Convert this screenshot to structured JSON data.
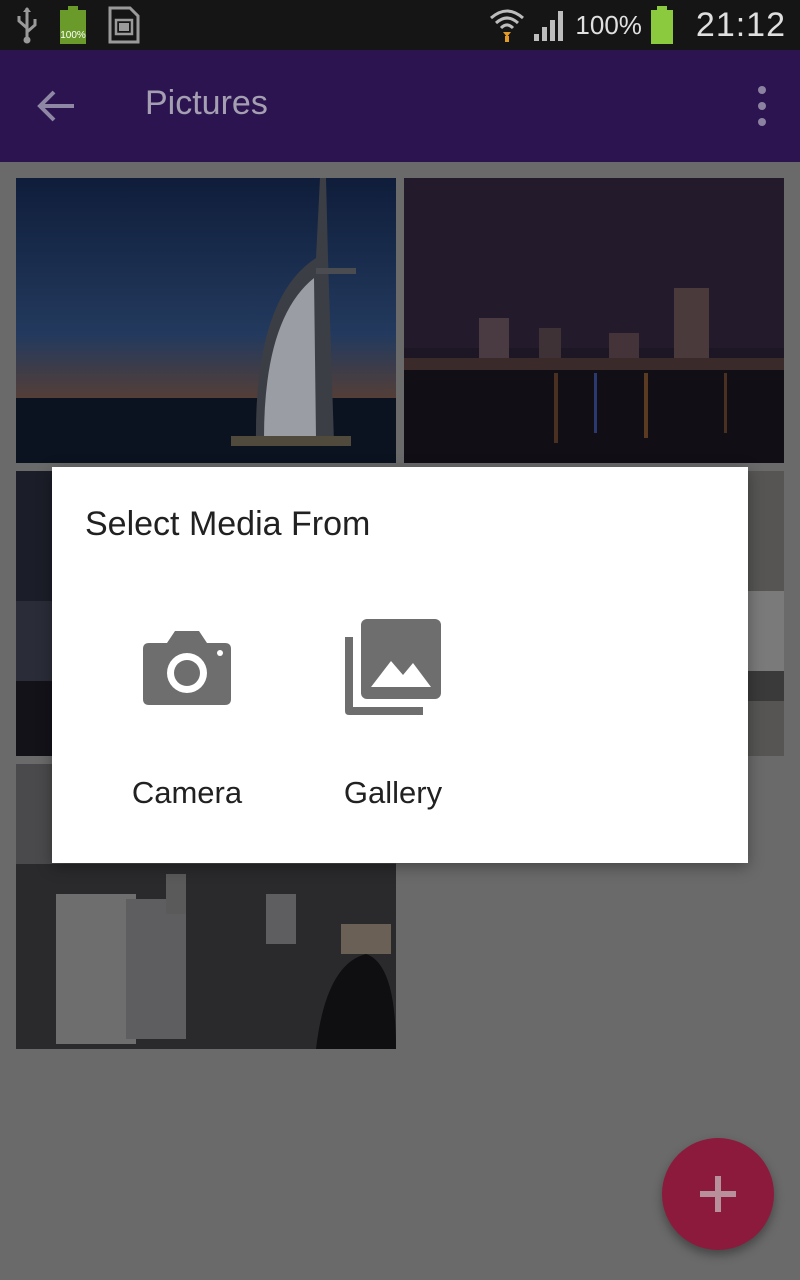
{
  "status_bar": {
    "icons_left": [
      "usb-icon",
      "battery-full-icon",
      "sd-card-icon"
    ],
    "battery_small_label": "100%",
    "battery_percent": "100%",
    "time": "21:12",
    "icons_right": [
      "wifi-icon",
      "signal-icon",
      "battery-icon"
    ]
  },
  "app_bar": {
    "title": "Pictures",
    "back_icon": "arrow-back-icon",
    "menu_icon": "more-vert-icon"
  },
  "grid": {
    "tiles": [
      {
        "subject": "burj-al-arab-dusk"
      },
      {
        "subject": "city-skyline-night-waterfront"
      },
      {
        "subject": "city-buildings-night"
      },
      {
        "subject": "street-buildings-car"
      },
      {
        "subject": "market-street-crowd"
      }
    ]
  },
  "dialog": {
    "title": "Select Media From",
    "options": [
      {
        "label": "Camera",
        "icon": "camera-icon"
      },
      {
        "label": "Gallery",
        "icon": "gallery-icon"
      }
    ]
  },
  "fab": {
    "icon": "add-icon"
  },
  "colors": {
    "app_bar": "#2b1450",
    "accent": "#8c1a3c",
    "dialog_icon": "#6e6e6e",
    "scrim": "#6a6a6a"
  }
}
